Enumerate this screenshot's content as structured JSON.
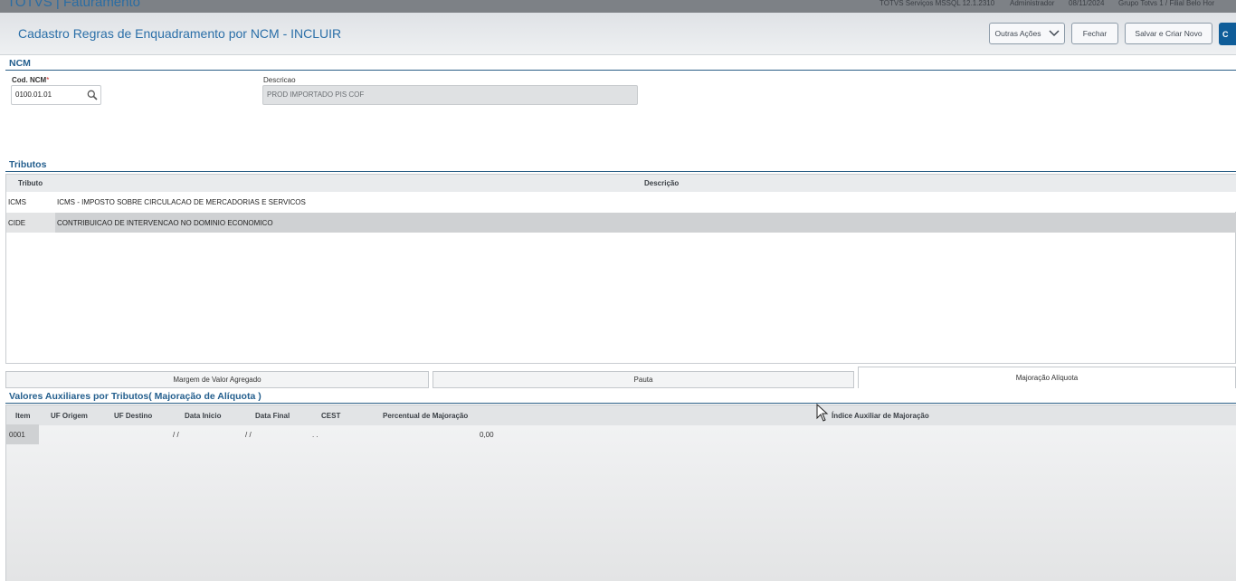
{
  "app": {
    "title": "TOTVS | Faturamento",
    "server": "TOTVS Serviços MSSQL 12.1.2310",
    "user": "Administrador",
    "date": "08/11/2024",
    "company": "Grupo Totvs 1 / Filial Belo Hor"
  },
  "header": {
    "title": "Cadastro Regras de Enquadramento por NCM - INCLUIR",
    "buttons": {
      "other_actions": "Outras Ações",
      "close": "Fechar",
      "save_new": "Salvar e Criar Novo",
      "confirm": "C"
    }
  },
  "ncm_section": {
    "title": "NCM",
    "code_label": "Cod. NCM",
    "code_required_mark": "*",
    "code_value": "0100.01.01",
    "description_label": "Descricao",
    "description_value": "PROD IMPORTADO PIS COF"
  },
  "tributos": {
    "title": "Tributos",
    "columns": [
      "Tributo",
      "Descrição"
    ],
    "rows": [
      {
        "tributo": "ICMS",
        "descricao": "ICMS - IMPOSTO SOBRE CIRCULACAO DE MERCADORIAS E SERVICOS"
      },
      {
        "tributo": "CIDE",
        "descricao": "CONTRIBUICAO DE INTERVENCAO NO DOMINIO ECONOMICO"
      }
    ]
  },
  "tabs": [
    "Margem de Valor Agregado",
    "Pauta",
    "Majoração Alíquota"
  ],
  "aux_section": {
    "title": "Valores Auxiliares por Tributos( Majoração de Alíquota )",
    "columns": [
      "Item",
      "UF Origem",
      "UF Destino",
      "Data Inicio",
      "Data Final",
      "CEST",
      "Percentual de Majoração",
      "Índice Auxiliar de Majoração"
    ],
    "rows": [
      {
        "item": "0001",
        "uf_origem": "",
        "uf_destino": "",
        "data_inicio": "/ /",
        "data_final": "/ /",
        "cest": ". .",
        "percentual": "0,00",
        "indice": ""
      }
    ]
  },
  "icons": {
    "search": "search-icon",
    "chevron": "chevron-down-icon",
    "cursor": "mouse-cursor-icon"
  },
  "colors": {
    "accent": "#2b6fa8",
    "section_rule": "#2b5f86",
    "confirm_button": "#0f5d99",
    "selected_row": "#cfd1d3"
  }
}
